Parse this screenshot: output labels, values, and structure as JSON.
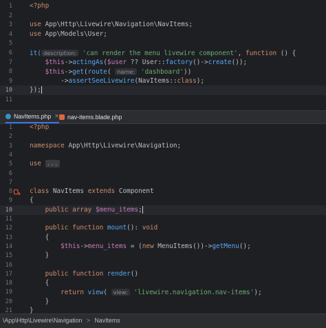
{
  "top_editor": {
    "lines": [
      {
        "n": "1",
        "segments": [
          {
            "t": "<?php",
            "c": "k"
          }
        ]
      },
      {
        "n": "2",
        "segments": []
      },
      {
        "n": "3",
        "segments": [
          {
            "t": "use ",
            "c": "k"
          },
          {
            "t": "App\\Http\\Livewire\\Navigation\\NavItems;",
            "c": "t"
          }
        ]
      },
      {
        "n": "4",
        "segments": [
          {
            "t": "use ",
            "c": "k"
          },
          {
            "t": "App\\Models\\User;",
            "c": "t"
          }
        ]
      },
      {
        "n": "5",
        "segments": []
      },
      {
        "n": "6",
        "segments": [
          {
            "t": "it(",
            "c": "f"
          },
          {
            "t": "description:",
            "c": "hint"
          },
          {
            "t": " 'can render the menu livewire component'",
            "c": "s"
          },
          {
            "t": ", ",
            "c": "t"
          },
          {
            "t": "function",
            "c": "k"
          },
          {
            "t": " () {",
            "c": "t"
          }
        ]
      },
      {
        "n": "7",
        "segments": [
          {
            "t": "    $this",
            "c": "v"
          },
          {
            "t": "->",
            "c": "t"
          },
          {
            "t": "actingAs",
            "c": "f"
          },
          {
            "t": "(",
            "c": "t"
          },
          {
            "t": "$user",
            "c": "v"
          },
          {
            "t": " ?? ",
            "c": "t"
          },
          {
            "t": "User",
            "c": "t"
          },
          {
            "t": "::",
            "c": "t"
          },
          {
            "t": "factory",
            "c": "f"
          },
          {
            "t": "()->",
            "c": "t"
          },
          {
            "t": "create",
            "c": "f"
          },
          {
            "t": "());",
            "c": "t"
          }
        ]
      },
      {
        "n": "8",
        "segments": [
          {
            "t": "    $this",
            "c": "v"
          },
          {
            "t": "->",
            "c": "t"
          },
          {
            "t": "get",
            "c": "f"
          },
          {
            "t": "(",
            "c": "t"
          },
          {
            "t": "route",
            "c": "f"
          },
          {
            "t": "( ",
            "c": "t"
          },
          {
            "t": "name:",
            "c": "hint"
          },
          {
            "t": " 'dashboard'",
            "c": "s"
          },
          {
            "t": "))",
            "c": "t"
          }
        ]
      },
      {
        "n": "9",
        "segments": [
          {
            "t": "        ->",
            "c": "t"
          },
          {
            "t": "assertSeeLivewire",
            "c": "f"
          },
          {
            "t": "(",
            "c": "t"
          },
          {
            "t": "NavItems",
            "c": "t"
          },
          {
            "t": "::",
            "c": "t"
          },
          {
            "t": "class",
            "c": "k"
          },
          {
            "t": ");",
            "c": "t"
          }
        ]
      },
      {
        "n": "10",
        "segments": [
          {
            "t": "});",
            "c": "t"
          }
        ],
        "current": true
      },
      {
        "n": "11",
        "segments": []
      }
    ]
  },
  "tabs": [
    {
      "label": "NavItems.php",
      "active": true,
      "icon_color": "#3592c4"
    },
    {
      "label": "nav-items.blade.php",
      "active": false,
      "icon_color": "#e0663f"
    }
  ],
  "bottom_editor": {
    "lines": [
      {
        "n": "1",
        "segments": [
          {
            "t": "<?php",
            "c": "k"
          }
        ]
      },
      {
        "n": "2",
        "segments": []
      },
      {
        "n": "3",
        "segments": [
          {
            "t": "namespace ",
            "c": "k"
          },
          {
            "t": "App\\Http\\Livewire\\Navigation;",
            "c": "t"
          }
        ]
      },
      {
        "n": "4",
        "segments": []
      },
      {
        "n": "5",
        "segments": [
          {
            "t": "use ",
            "c": "k"
          },
          {
            "t": "...",
            "c": "fold"
          }
        ]
      },
      {
        "n": "6",
        "segments": []
      },
      {
        "n": "7",
        "segments": []
      },
      {
        "n": "8",
        "segments": [
          {
            "t": "class ",
            "c": "k"
          },
          {
            "t": "NavItems ",
            "c": "t"
          },
          {
            "t": "extends ",
            "c": "k"
          },
          {
            "t": "Component",
            "c": "t"
          }
        ],
        "laravel": true
      },
      {
        "n": "9",
        "segments": [
          {
            "t": "{",
            "c": "t"
          }
        ]
      },
      {
        "n": "10",
        "segments": [
          {
            "t": "    public ",
            "c": "k"
          },
          {
            "t": "array ",
            "c": "k"
          },
          {
            "t": "$menu_items",
            "c": "v"
          },
          {
            "t": ";",
            "c": "t"
          }
        ],
        "current": true
      },
      {
        "n": "11",
        "segments": []
      },
      {
        "n": "12",
        "segments": [
          {
            "t": "    public ",
            "c": "k"
          },
          {
            "t": "function ",
            "c": "k"
          },
          {
            "t": "mount",
            "c": "f"
          },
          {
            "t": "(): ",
            "c": "t"
          },
          {
            "t": "void",
            "c": "k"
          }
        ]
      },
      {
        "n": "13",
        "segments": [
          {
            "t": "    {",
            "c": "t"
          }
        ]
      },
      {
        "n": "14",
        "segments": [
          {
            "t": "        $this",
            "c": "v"
          },
          {
            "t": "->",
            "c": "t"
          },
          {
            "t": "menu_items",
            "c": "v"
          },
          {
            "t": " = (",
            "c": "t"
          },
          {
            "t": "new ",
            "c": "k"
          },
          {
            "t": "MenuItems",
            "c": "t"
          },
          {
            "t": "())->",
            "c": "t"
          },
          {
            "t": "getMenu",
            "c": "f"
          },
          {
            "t": "();",
            "c": "t"
          }
        ]
      },
      {
        "n": "15",
        "segments": [
          {
            "t": "    }",
            "c": "t"
          }
        ]
      },
      {
        "n": "16",
        "segments": []
      },
      {
        "n": "17",
        "segments": [
          {
            "t": "    public ",
            "c": "k"
          },
          {
            "t": "function ",
            "c": "k"
          },
          {
            "t": "render",
            "c": "f"
          },
          {
            "t": "()",
            "c": "t"
          }
        ]
      },
      {
        "n": "18",
        "segments": [
          {
            "t": "    {",
            "c": "t"
          }
        ]
      },
      {
        "n": "19",
        "segments": [
          {
            "t": "        return ",
            "c": "k"
          },
          {
            "t": "view",
            "c": "f"
          },
          {
            "t": "( ",
            "c": "t"
          },
          {
            "t": "view:",
            "c": "hint"
          },
          {
            "t": " 'livewire.navigation.nav-items'",
            "c": "s"
          },
          {
            "t": ");",
            "c": "t"
          }
        ]
      },
      {
        "n": "20",
        "segments": [
          {
            "t": "    }",
            "c": "t"
          }
        ]
      },
      {
        "n": "21",
        "segments": [
          {
            "t": "}",
            "c": "t"
          }
        ]
      }
    ]
  },
  "breadcrumb": {
    "path": "\\App\\Http\\Livewire\\Navigation",
    "separator": ">",
    "current": "NavItems"
  }
}
